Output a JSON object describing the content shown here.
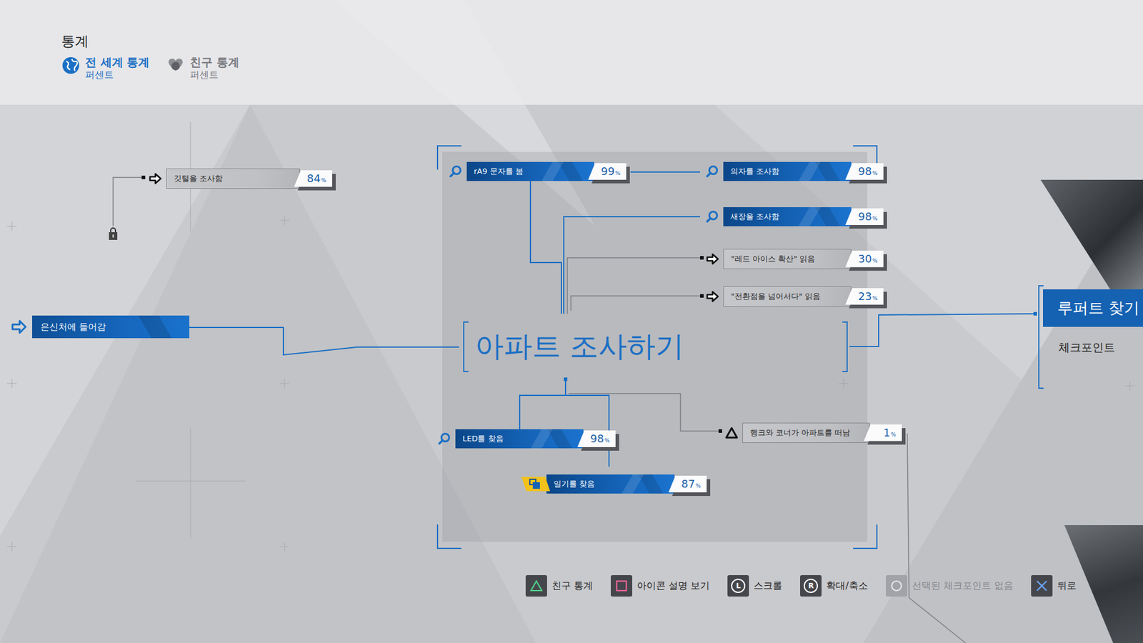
{
  "screen": {
    "title": "통계"
  },
  "tabs": [
    {
      "label": "전 세계 통계",
      "sublabel": "퍼센트",
      "selected": true
    },
    {
      "label": "친구 통계",
      "sublabel": "퍼센트",
      "selected": false
    }
  ],
  "flowchart": {
    "scene": "아파트 조사하기",
    "entry": {
      "label": "은신처에 들어감"
    },
    "nodes": [
      {
        "label": "깃털을 조사함",
        "value": "84",
        "unit": "%",
        "kind": "arrow",
        "reached": false,
        "locked": true
      },
      {
        "label": "rA9 문자를 봄",
        "value": "99",
        "unit": "%",
        "kind": "search",
        "reached": true,
        "locked": false
      },
      {
        "label": "의자를 조사함",
        "value": "98",
        "unit": "%",
        "kind": "search",
        "reached": true,
        "locked": false
      },
      {
        "label": "새장을 조사함",
        "value": "98",
        "unit": "%",
        "kind": "search",
        "reached": true,
        "locked": false
      },
      {
        "label": "\"레드 아이스 확산\" 읽음",
        "value": "30",
        "unit": "%",
        "kind": "arrow",
        "reached": false,
        "locked": false
      },
      {
        "label": "\"전환점을 넘어서다\" 읽음",
        "value": "23",
        "unit": "%",
        "kind": "arrow",
        "reached": false,
        "locked": false
      },
      {
        "label": "LED를 찾음",
        "value": "98",
        "unit": "%",
        "kind": "search",
        "reached": true,
        "locked": false
      },
      {
        "label": "일기를 찾음",
        "value": "87",
        "unit": "%",
        "kind": "diary",
        "reached": true,
        "locked": false
      },
      {
        "label": "행크와 코너가 아파트를 떠남",
        "value": "1",
        "unit": "%",
        "kind": "triangle",
        "reached": false,
        "locked": false
      }
    ],
    "checkpoint": {
      "label": "루퍼트 찾기",
      "sublabel": "체크포인트"
    }
  },
  "controls": [
    {
      "kind": "triangle",
      "label": "친구 통계",
      "disabled": false
    },
    {
      "kind": "square",
      "label": "아이콘 설명 보기",
      "disabled": false
    },
    {
      "kind": "lstick",
      "key": "L",
      "label": "스크롤",
      "disabled": false
    },
    {
      "kind": "rstick",
      "key": "R",
      "label": "확대/축소",
      "disabled": false
    },
    {
      "kind": "circle",
      "label": "선택된 체크포인트 없음",
      "disabled": true
    },
    {
      "kind": "cross",
      "label": "뒤로",
      "disabled": false
    }
  ]
}
